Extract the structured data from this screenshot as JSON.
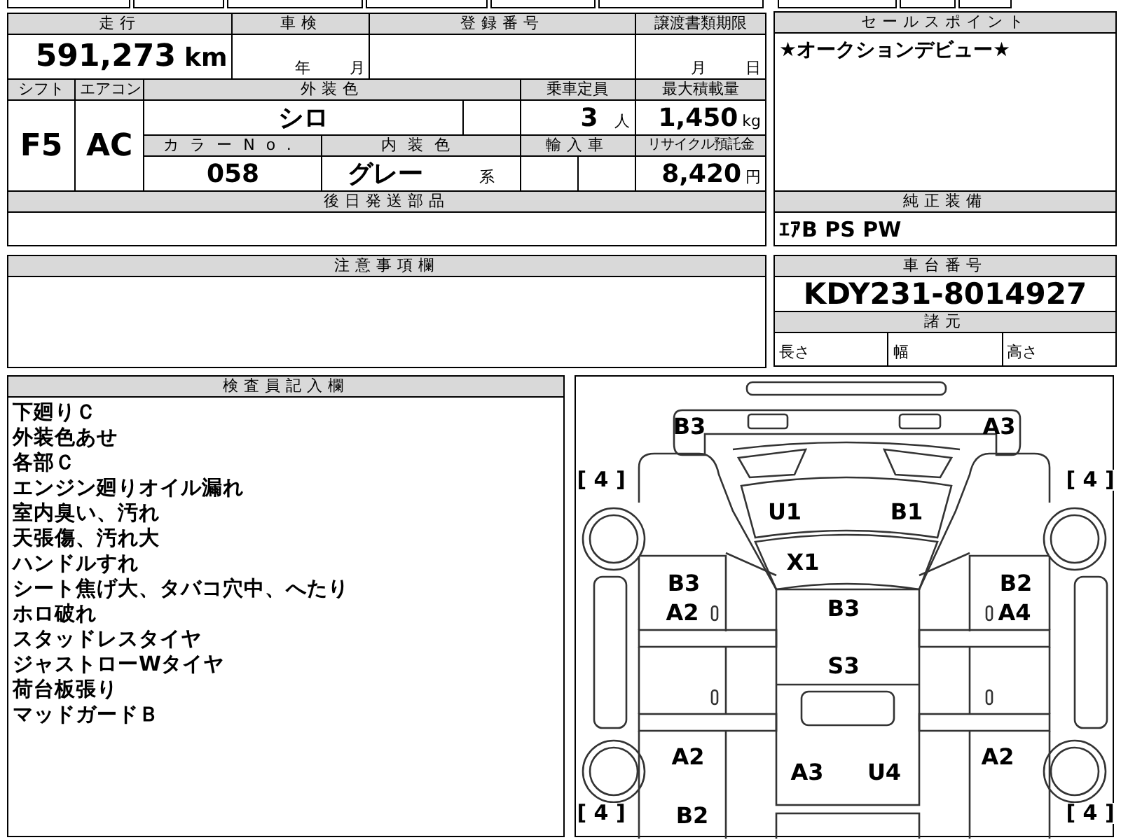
{
  "vehicle_info": {
    "mileage": {
      "label": "走行",
      "value": "591,273",
      "unit": "km"
    },
    "inspection": {
      "label": "車検",
      "year_unit": "年",
      "month_unit": "月"
    },
    "registration_number": {
      "label": "登録番号"
    },
    "transfer_deadline": {
      "label": "譲渡書類期限",
      "month_unit": "月",
      "day_unit": "日"
    },
    "shift": {
      "label": "シフト",
      "value": "F5"
    },
    "air_conditioner": {
      "label": "エアコン",
      "value": "AC"
    },
    "exterior_color": {
      "label": "外装色",
      "value": "シロ"
    },
    "capacity": {
      "label": "乗車定員",
      "value": "3",
      "unit": "人"
    },
    "max_load": {
      "label": "最大積載量",
      "value": "1,450",
      "unit": "kg"
    },
    "color_no": {
      "label": "カラーNo.",
      "value": "058"
    },
    "interior_color": {
      "label": "内装色",
      "value": "グレー",
      "suffix": "系"
    },
    "imported": {
      "label": "輸入車"
    },
    "recycle_fee": {
      "label": "リサイクル預託金",
      "value": "8,420",
      "unit": "円"
    },
    "later_parts": {
      "label": "後日発送部品"
    }
  },
  "sales_points": {
    "label": "セールスポイント",
    "text": "★オークションデビュー★"
  },
  "equipment": {
    "label": "純正装備",
    "text": "ｴｱB PS PW"
  },
  "notes": {
    "label": "注意事項欄"
  },
  "chassis": {
    "label": "車台番号",
    "value": "KDY231-8014927"
  },
  "specs": {
    "label": "諸元",
    "cells": [
      "長さ",
      "幅",
      "高さ"
    ]
  },
  "inspector": {
    "label": "検査員記入欄",
    "lines": [
      "下廻りＣ",
      "外装色あせ",
      "各部Ｃ",
      "エンジン廻りオイル漏れ",
      "室内臭い、汚れ",
      "天張傷、汚れ大",
      "ハンドルすれ",
      "シート焦げ大、タバコ穴中、へたり",
      "ホロ破れ",
      "スタッドレスタイヤ",
      "ジャストローWタイヤ",
      "荷台板張り",
      "マッドガードＢ"
    ]
  },
  "diagram": {
    "marks": [
      {
        "kind": "damage",
        "text": "B3"
      },
      {
        "kind": "damage",
        "text": "A3"
      },
      {
        "kind": "tire",
        "text": "[ 4 ]"
      },
      {
        "kind": "tire",
        "text": "[ 4 ]"
      },
      {
        "kind": "damage",
        "text": "U1"
      },
      {
        "kind": "damage",
        "text": "B1"
      },
      {
        "kind": "damage",
        "text": "X1"
      },
      {
        "kind": "damage",
        "text": "B3"
      },
      {
        "kind": "damage",
        "text": "A2"
      },
      {
        "kind": "damage",
        "text": "B3"
      },
      {
        "kind": "damage",
        "text": "B2"
      },
      {
        "kind": "damage",
        "text": "A4"
      },
      {
        "kind": "damage",
        "text": "S3"
      },
      {
        "kind": "damage",
        "text": "A2"
      },
      {
        "kind": "damage",
        "text": "A3"
      },
      {
        "kind": "damage",
        "text": "U4"
      },
      {
        "kind": "damage",
        "text": "A2"
      },
      {
        "kind": "tire",
        "text": "[ 4 ]"
      },
      {
        "kind": "damage",
        "text": "B2"
      },
      {
        "kind": "tire",
        "text": "[ 4 ]"
      }
    ]
  }
}
